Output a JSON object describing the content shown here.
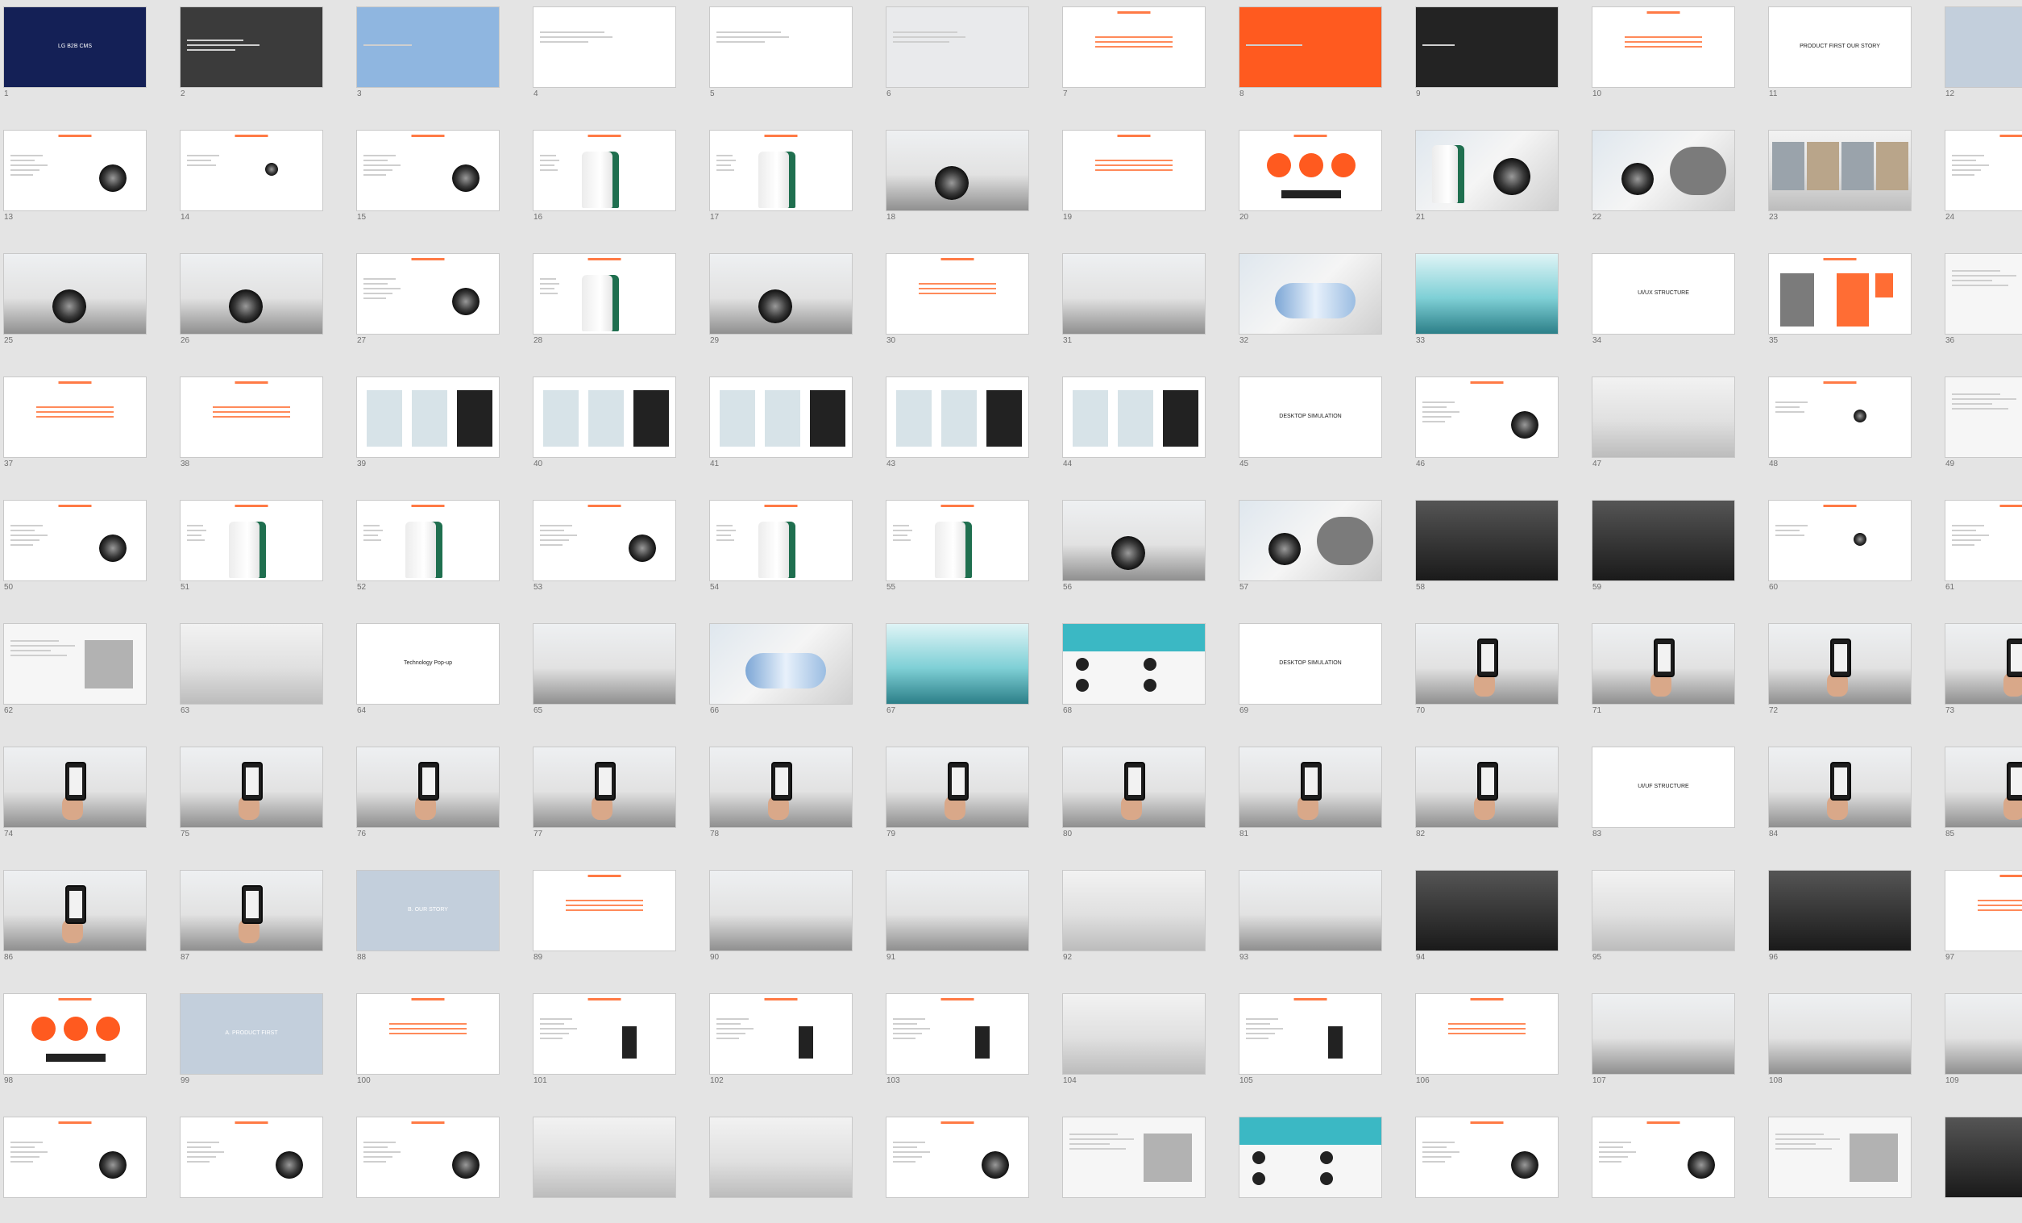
{
  "colors": {
    "background": "#e4e4e4",
    "accent_orange": "#ff5a1f",
    "navy": "#142056",
    "sky": "#8fb6e0",
    "slide_number": "#6f6f6f"
  },
  "slides": [
    {
      "num": "1",
      "kind": "navy",
      "title": "LG B2B CMS"
    },
    {
      "num": "2",
      "kind": "charcoal",
      "title": ""
    },
    {
      "num": "3",
      "kind": "sky",
      "title": ""
    },
    {
      "num": "4",
      "kind": "text",
      "title": ""
    },
    {
      "num": "5",
      "kind": "text",
      "title": ""
    },
    {
      "num": "6",
      "kind": "lightgray",
      "title": ""
    },
    {
      "num": "7",
      "kind": "accent",
      "title": ""
    },
    {
      "num": "8",
      "kind": "orange",
      "title": ""
    },
    {
      "num": "9",
      "kind": "dark",
      "title": ""
    },
    {
      "num": "10",
      "kind": "accent",
      "title": ""
    },
    {
      "num": "11",
      "kind": "text",
      "title": "PRODUCT FIRST        OUR STORY"
    },
    {
      "num": "12",
      "kind": "steel",
      "title": ""
    },
    {
      "num": "13",
      "kind": "layout-device",
      "title": ""
    },
    {
      "num": "14",
      "kind": "layout-device-small",
      "title": ""
    },
    {
      "num": "15",
      "kind": "layout-device",
      "title": ""
    },
    {
      "num": "16",
      "kind": "tower",
      "title": ""
    },
    {
      "num": "17",
      "kind": "tower",
      "title": ""
    },
    {
      "num": "18",
      "kind": "room-device",
      "title": ""
    },
    {
      "num": "19",
      "kind": "accent",
      "title": ""
    },
    {
      "num": "20",
      "kind": "circles",
      "title": ""
    },
    {
      "num": "21",
      "kind": "tower-device",
      "title": ""
    },
    {
      "num": "22",
      "kind": "device-dark",
      "title": ""
    },
    {
      "num": "23",
      "kind": "photo-grid",
      "title": ""
    },
    {
      "num": "24",
      "kind": "layout-device",
      "title": ""
    },
    {
      "num": "25",
      "kind": "room-device",
      "title": ""
    },
    {
      "num": "26",
      "kind": "room-device",
      "title": ""
    },
    {
      "num": "27",
      "kind": "layout-device",
      "title": ""
    },
    {
      "num": "28",
      "kind": "tower",
      "title": ""
    },
    {
      "num": "29",
      "kind": "room-device",
      "title": ""
    },
    {
      "num": "30",
      "kind": "accent",
      "title": ""
    },
    {
      "num": "31",
      "kind": "room",
      "title": ""
    },
    {
      "num": "32",
      "kind": "capsule",
      "title": ""
    },
    {
      "num": "33",
      "kind": "teal",
      "title": ""
    },
    {
      "num": "34",
      "kind": "text",
      "title": "UI/UX STRUCTURE"
    },
    {
      "num": "35",
      "kind": "blocks",
      "title": ""
    },
    {
      "num": "36",
      "kind": "mixed",
      "title": ""
    },
    {
      "num": "37",
      "kind": "accent",
      "title": ""
    },
    {
      "num": "38",
      "kind": "accent",
      "title": ""
    },
    {
      "num": "39",
      "kind": "wire",
      "title": ""
    },
    {
      "num": "40",
      "kind": "wire",
      "title": ""
    },
    {
      "num": "41",
      "kind": "wire",
      "title": ""
    },
    {
      "num": "43",
      "kind": "wire",
      "title": ""
    },
    {
      "num": "44",
      "kind": "wire",
      "title": ""
    },
    {
      "num": "45",
      "kind": "text",
      "title": "DESKTOP SIMULATION"
    },
    {
      "num": "46",
      "kind": "layout-device",
      "title": ""
    },
    {
      "num": "47",
      "kind": "photo",
      "title": ""
    },
    {
      "num": "48",
      "kind": "layout-device-small",
      "title": ""
    },
    {
      "num": "49",
      "kind": "mixed",
      "title": ""
    },
    {
      "num": "50",
      "kind": "layout-device",
      "title": ""
    },
    {
      "num": "51",
      "kind": "tower",
      "title": ""
    },
    {
      "num": "52",
      "kind": "tower",
      "title": ""
    },
    {
      "num": "53",
      "kind": "layout-device",
      "title": ""
    },
    {
      "num": "54",
      "kind": "tower",
      "title": ""
    },
    {
      "num": "55",
      "kind": "tower",
      "title": ""
    },
    {
      "num": "56",
      "kind": "room-device",
      "title": ""
    },
    {
      "num": "57",
      "kind": "device-dark",
      "title": ""
    },
    {
      "num": "58",
      "kind": "darkphoto",
      "title": ""
    },
    {
      "num": "59",
      "kind": "darkphoto",
      "title": ""
    },
    {
      "num": "60",
      "kind": "layout-device-small",
      "title": ""
    },
    {
      "num": "61",
      "kind": "layout-device",
      "title": ""
    },
    {
      "num": "62",
      "kind": "mixed",
      "title": ""
    },
    {
      "num": "63",
      "kind": "photo",
      "title": ""
    },
    {
      "num": "64",
      "kind": "text",
      "title": "Technology Pop-up"
    },
    {
      "num": "65",
      "kind": "room",
      "title": ""
    },
    {
      "num": "66",
      "kind": "capsule",
      "title": ""
    },
    {
      "num": "67",
      "kind": "teal",
      "title": ""
    },
    {
      "num": "68",
      "kind": "teal-grid",
      "title": ""
    },
    {
      "num": "69",
      "kind": "text",
      "title": "DESKTOP SIMULATION"
    },
    {
      "num": "70",
      "kind": "phone",
      "title": ""
    },
    {
      "num": "71",
      "kind": "phone",
      "title": ""
    },
    {
      "num": "72",
      "kind": "phone",
      "title": ""
    },
    {
      "num": "73",
      "kind": "phone",
      "title": ""
    },
    {
      "num": "74",
      "kind": "phone",
      "title": ""
    },
    {
      "num": "75",
      "kind": "phone",
      "title": ""
    },
    {
      "num": "76",
      "kind": "phone",
      "title": ""
    },
    {
      "num": "77",
      "kind": "phone",
      "title": ""
    },
    {
      "num": "78",
      "kind": "phone",
      "title": ""
    },
    {
      "num": "79",
      "kind": "phone",
      "title": ""
    },
    {
      "num": "80",
      "kind": "phone",
      "title": ""
    },
    {
      "num": "81",
      "kind": "phone",
      "title": ""
    },
    {
      "num": "82",
      "kind": "phone",
      "title": ""
    },
    {
      "num": "83",
      "kind": "text",
      "title": "UI/UF STRUCTURE"
    },
    {
      "num": "84",
      "kind": "phone",
      "title": ""
    },
    {
      "num": "85",
      "kind": "phone",
      "title": ""
    },
    {
      "num": "86",
      "kind": "phone",
      "title": ""
    },
    {
      "num": "87",
      "kind": "phone",
      "title": ""
    },
    {
      "num": "88",
      "kind": "steel",
      "title": "B. OUR STORY"
    },
    {
      "num": "89",
      "kind": "accent",
      "title": ""
    },
    {
      "num": "90",
      "kind": "room",
      "title": ""
    },
    {
      "num": "91",
      "kind": "room",
      "title": ""
    },
    {
      "num": "92",
      "kind": "photo",
      "title": ""
    },
    {
      "num": "93",
      "kind": "room",
      "title": ""
    },
    {
      "num": "94",
      "kind": "darkphoto",
      "title": ""
    },
    {
      "num": "95",
      "kind": "photo",
      "title": ""
    },
    {
      "num": "96",
      "kind": "darkphoto",
      "title": ""
    },
    {
      "num": "97",
      "kind": "accent",
      "title": ""
    },
    {
      "num": "98",
      "kind": "circles",
      "title": ""
    },
    {
      "num": "99",
      "kind": "steel",
      "title": "A. PRODUCT FIRST"
    },
    {
      "num": "100",
      "kind": "accent",
      "title": ""
    },
    {
      "num": "101",
      "kind": "layout-tower-dark",
      "title": ""
    },
    {
      "num": "102",
      "kind": "layout-tower-dark",
      "title": ""
    },
    {
      "num": "103",
      "kind": "layout-tower-dark",
      "title": ""
    },
    {
      "num": "104",
      "kind": "photo",
      "title": ""
    },
    {
      "num": "105",
      "kind": "layout-tower-dark",
      "title": ""
    },
    {
      "num": "106",
      "kind": "accent",
      "title": ""
    },
    {
      "num": "107",
      "kind": "room",
      "title": ""
    },
    {
      "num": "108",
      "kind": "room",
      "title": ""
    },
    {
      "num": "109",
      "kind": "room",
      "title": ""
    },
    {
      "num": "",
      "kind": "layout-device",
      "title": ""
    },
    {
      "num": "",
      "kind": "layout-device",
      "title": ""
    },
    {
      "num": "",
      "kind": "layout-device",
      "title": ""
    },
    {
      "num": "",
      "kind": "photo",
      "title": ""
    },
    {
      "num": "",
      "kind": "photo",
      "title": ""
    },
    {
      "num": "",
      "kind": "layout-device",
      "title": ""
    },
    {
      "num": "",
      "kind": "mixed",
      "title": ""
    },
    {
      "num": "",
      "kind": "teal-grid",
      "title": ""
    },
    {
      "num": "",
      "kind": "layout-device",
      "title": ""
    },
    {
      "num": "",
      "kind": "layout-device",
      "title": ""
    },
    {
      "num": "",
      "kind": "mixed",
      "title": ""
    },
    {
      "num": "",
      "kind": "darkphoto",
      "title": ""
    }
  ]
}
